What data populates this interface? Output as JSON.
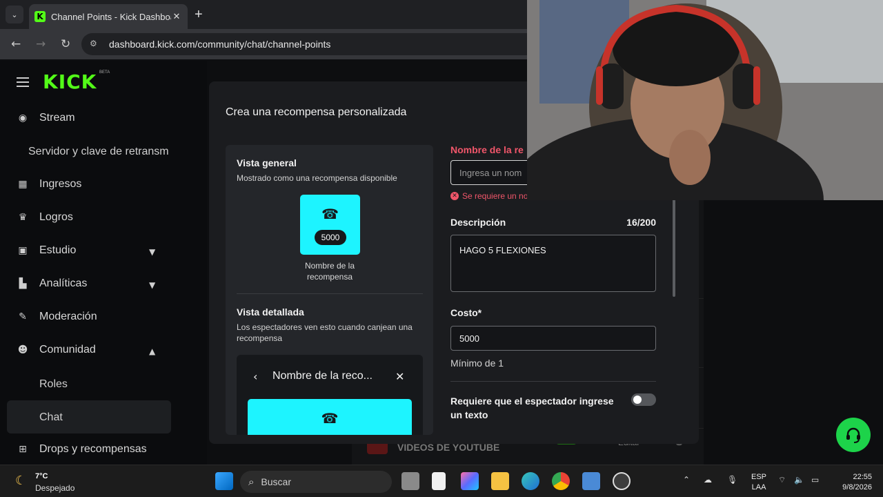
{
  "browser": {
    "tab_title": "Channel Points - Kick Dashboar",
    "url": "dashboard.kick.com/community/chat/channel-points"
  },
  "sidebar": {
    "logo": "KICK",
    "logo_badge": "BETA",
    "items": [
      {
        "label": "Stream"
      },
      {
        "label": "Servidor y clave de retransm"
      },
      {
        "label": "Ingresos"
      },
      {
        "label": "Logros"
      },
      {
        "label": "Estudio"
      },
      {
        "label": "Analíticas"
      },
      {
        "label": "Moderación"
      },
      {
        "label": "Comunidad"
      },
      {
        "label": "Roles"
      },
      {
        "label": "Chat"
      },
      {
        "label": "Drops y recompensas"
      }
    ]
  },
  "background_page": {
    "youtube_reward": "VIDEOS DE YOUTUBE",
    "edit_label": "Editar"
  },
  "modal": {
    "title": "Crea una recompensa personalizada",
    "overview": {
      "heading": "Vista general",
      "subtitle": "Mostrado como una recompensa disponible",
      "cost": "5000",
      "caption": "Nombre de la recompensa"
    },
    "detail": {
      "heading": "Vista detallada",
      "subtitle": "Los espectadores ven esto cuando canjean una recompensa",
      "card_title": "Nombre de la reco..."
    },
    "form": {
      "name_label": "Nombre de la re",
      "name_placeholder": "Ingresa un nom",
      "name_error": "Se requiere un no",
      "description_label": "Descripción",
      "description_count": "16/200",
      "description_value": "HAGO 5 FLEXIONES",
      "cost_label": "Costo*",
      "cost_value": "5000",
      "cost_hint": "Mínimo de 1",
      "require_text_label": "Requiere que el espectador ingrese un texto",
      "require_text_enabled": false
    }
  },
  "taskbar": {
    "temperature": "7°C",
    "weather": "Despejado",
    "search_placeholder": "Buscar",
    "lang_line1": "ESP",
    "lang_line2": "LAA",
    "time": "22:55",
    "date": "9/8/2026"
  },
  "colors": {
    "kick_green": "#53fc18",
    "reward_cyan": "#1df4ff",
    "error_red": "#f0566a",
    "support_green": "#1dd34a"
  }
}
